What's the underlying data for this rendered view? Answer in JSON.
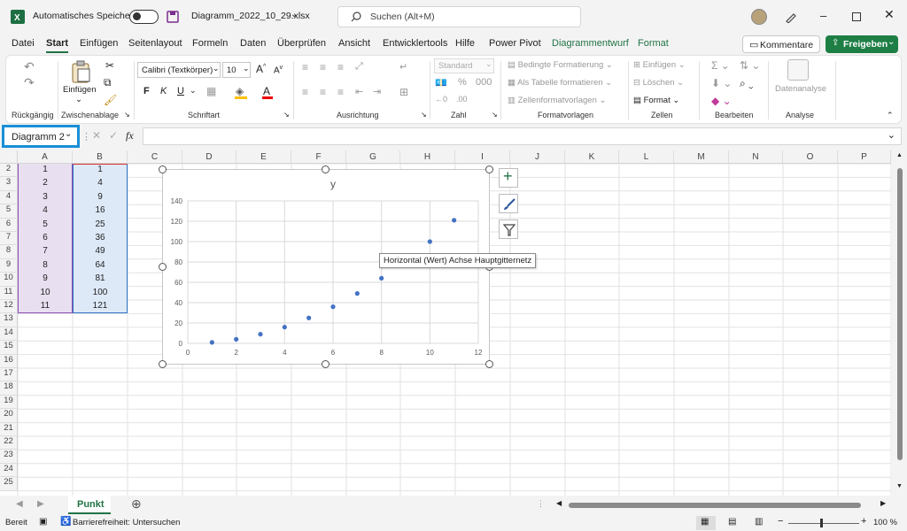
{
  "app": {
    "autosave_label": "Automatisches Speichern",
    "filename": "Diagramm_2022_10_29.xlsx",
    "search_placeholder": "Suchen (Alt+M)"
  },
  "menu": {
    "tabs": [
      "Datei",
      "Start",
      "Einfügen",
      "Seitenlayout",
      "Formeln",
      "Daten",
      "Überprüfen",
      "Ansicht",
      "Entwicklertools",
      "Hilfe",
      "Power Pivot",
      "Diagrammentwurf",
      "Format"
    ],
    "comments_label": "Kommentare",
    "share_label": "Freigeben"
  },
  "ribbon": {
    "undo_group": "Rückgängig",
    "clipboard_group": "Zwischenablage",
    "paste_label": "Einfügen",
    "font_group": "Schriftart",
    "font_name": "Calibri (Textkörper)",
    "font_size": "10",
    "alignment_group": "Ausrichtung",
    "number_group": "Zahl",
    "number_format": "Standard",
    "styles_group": "Formatvorlagen",
    "cond_format": "Bedingte Formatierung",
    "as_table": "Als Tabelle formatieren",
    "cell_styles": "Zellenformatvorlagen",
    "cells_group": "Zellen",
    "insert_cells": "Einfügen",
    "delete_cells": "Löschen",
    "format_cells": "Format",
    "edit_group": "Bearbeiten",
    "analysis_group": "Analyse",
    "data_analysis": "Datenanalyse"
  },
  "formula": {
    "name_box": "Diagramm 2",
    "fx": "fx"
  },
  "grid": {
    "columns": [
      "A",
      "B",
      "C",
      "D",
      "E",
      "F",
      "G",
      "H",
      "I",
      "J",
      "K",
      "L",
      "M",
      "N",
      "O",
      "P"
    ],
    "rows": [
      "2",
      "3",
      "4",
      "5",
      "6",
      "7",
      "8",
      "9",
      "10",
      "11",
      "12",
      "13",
      "14",
      "15",
      "16",
      "17",
      "18",
      "19",
      "20",
      "21",
      "22",
      "23",
      "24",
      "25"
    ],
    "col_a": [
      "1",
      "2",
      "3",
      "4",
      "5",
      "6",
      "7",
      "8",
      "9",
      "10",
      "11"
    ],
    "col_b": [
      "1",
      "4",
      "9",
      "16",
      "25",
      "36",
      "49",
      "64",
      "81",
      "100",
      "121"
    ]
  },
  "chart_data": {
    "type": "scatter",
    "title": "y",
    "x": [
      1,
      2,
      3,
      4,
      5,
      6,
      7,
      8,
      10,
      11
    ],
    "y": [
      1,
      4,
      9,
      16,
      25,
      36,
      49,
      64,
      100,
      121
    ],
    "xlim": [
      0,
      12
    ],
    "ylim": [
      0,
      140
    ],
    "x_ticks": [
      "0",
      "2",
      "4",
      "6",
      "8",
      "10",
      "12"
    ],
    "y_ticks": [
      "0",
      "20",
      "40",
      "60",
      "80",
      "100",
      "120",
      "140"
    ],
    "grid": true,
    "color": "#4472c4"
  },
  "tooltip": "Horizontal (Wert) Achse Hauptgitternetz",
  "sheets": {
    "active": "Punkt"
  },
  "status": {
    "ready": "Bereit",
    "accessibility": "Barrierefreiheit: Untersuchen",
    "zoom": "100 %"
  },
  "colors": {
    "accent": "#217346",
    "selection": "#1a8fd6",
    "col_a_fill": "#e8dff0",
    "col_b_fill": "#dde9f7"
  }
}
